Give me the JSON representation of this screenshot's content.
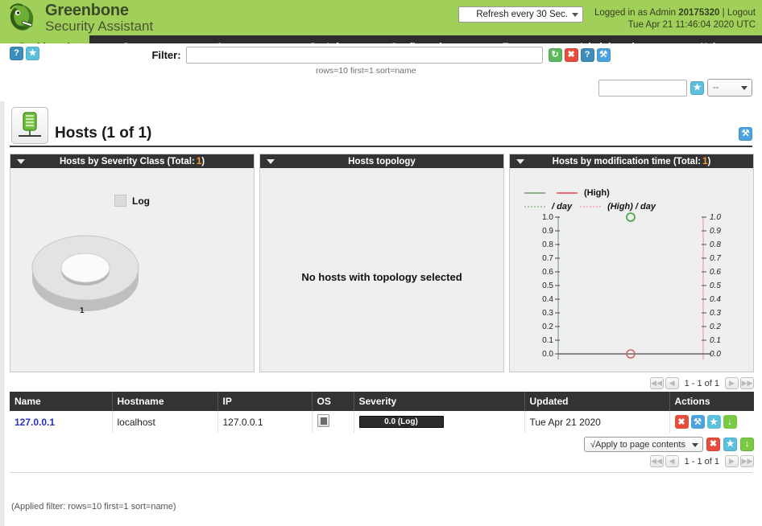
{
  "header": {
    "brand_line1": "Greenbone",
    "brand_line2": "Security Assistant",
    "logo_icon": "dragon-logo-icon",
    "refresh_select": "Refresh every 30 Sec.",
    "logged_in_prefix": "Logged in as",
    "role": "Admin",
    "username": "20175320",
    "separator": "|",
    "logout_label": "Logout",
    "datetime": "Tue Apr 21 11:46:04 2020 UTC"
  },
  "nav": {
    "items": [
      {
        "label": "Dashboard",
        "active": true
      },
      {
        "label": "Scans",
        "active": false
      },
      {
        "label": "Assets",
        "active": false
      },
      {
        "label": "SecInfo",
        "active": false
      },
      {
        "label": "Configuration",
        "active": false
      },
      {
        "label": "Extras",
        "active": false
      },
      {
        "label": "Administration",
        "active": false
      },
      {
        "label": "Help",
        "active": false
      }
    ]
  },
  "toolbar": {
    "help_icon": "?",
    "star_icon": "★",
    "filter_label": "Filter:",
    "filter_value": "",
    "filter_placeholder": "",
    "filter_summary": "rows=10 first=1 sort=name",
    "refresh_icon": "↻",
    "reset_icon": "✖",
    "help2_icon": "?",
    "wrench_icon": "⚒",
    "name_input_value": "",
    "name_star_icon": "★",
    "mini_select_value": "--"
  },
  "page": {
    "title": "Hosts (1 of 1)",
    "title_icon": "host-server-icon",
    "edit_icon": "⚒"
  },
  "dashboard": {
    "panels": [
      {
        "title_prefix": "Hosts by Severity Class (Total: ",
        "total": "1",
        "title_suffix": ")",
        "legend_label": "Log",
        "donut_value_label": "1"
      },
      {
        "title_prefix": "Hosts topology",
        "total": "",
        "title_suffix": "",
        "message": "No hosts with topology selected"
      },
      {
        "title_prefix": "Hosts by modification time (Total: ",
        "total": "1",
        "title_suffix": ")",
        "legend": [
          {
            "label": "",
            "style": "solid-green"
          },
          {
            "label": "(High)",
            "style": "solid-red"
          },
          {
            "label": "/ day",
            "style": "dotted-green"
          },
          {
            "label": "(High) / day",
            "style": "dotted-red"
          }
        ]
      }
    ]
  },
  "chart_data": {
    "type": "line",
    "title": "Hosts by modification time (Total: 1)",
    "xlabel": "",
    "ylabel": "",
    "ylim": [
      0.0,
      1.0
    ],
    "y_ticks": [
      "0.0",
      "0.1",
      "0.2",
      "0.3",
      "0.4",
      "0.5",
      "0.6",
      "0.7",
      "0.8",
      "0.9",
      "1.0"
    ],
    "y2_ticks": [
      "0.0",
      "0.1",
      "0.2",
      "0.3",
      "0.4",
      "0.5",
      "0.6",
      "0.7",
      "0.8",
      "0.9",
      "1.0"
    ],
    "grid": false,
    "legend_position": "top-left",
    "series": [
      {
        "name": "",
        "style": "solid",
        "color": "#7a9e7a",
        "x": [
          0
        ],
        "values": [
          1.0
        ],
        "marker": "circle-open"
      },
      {
        "name": "(High)",
        "style": "solid",
        "color": "#f06c7d",
        "x": [
          0
        ],
        "values": [
          0.0
        ],
        "marker": "circle-open"
      },
      {
        "name": "/ day",
        "style": "dotted",
        "color": "#a8c9a8",
        "x": [],
        "values": []
      },
      {
        "name": "(High) / day",
        "style": "dotted",
        "color": "#f7b3bc",
        "x": [],
        "values": []
      }
    ]
  },
  "pager": {
    "first_icon": "◀◀",
    "prev_icon": "◀",
    "range_text": "1 - 1 of 1",
    "next_icon": "▶",
    "last_icon": "▶▶"
  },
  "table": {
    "columns": [
      "Name",
      "Hostname",
      "IP",
      "OS",
      "Severity",
      "Updated",
      "Actions"
    ],
    "rows": [
      {
        "name": "127.0.0.1",
        "hostname": "localhost",
        "ip": "127.0.0.1",
        "os_icon": "os-unknown-icon",
        "severity": "0.0 (Log)",
        "updated": "Tue Apr 21 2020",
        "actions": [
          {
            "icon": "✖",
            "name": "delete-icon",
            "color": "#e74c3c"
          },
          {
            "icon": "⚒",
            "name": "edit-icon",
            "color": "#4aa3df"
          },
          {
            "icon": "★",
            "name": "clone-icon",
            "color": "#5bc0de"
          },
          {
            "icon": "↓",
            "name": "export-icon",
            "color": "#7ac943"
          }
        ]
      }
    ]
  },
  "footer": {
    "apply_select": "√Apply to page contents",
    "bulk_delete_icon": "✖",
    "bulk_clone_icon": "★",
    "bulk_export_icon": "↓",
    "applied_filter": "(Applied filter: rows=10 first=1 sort=name)"
  }
}
